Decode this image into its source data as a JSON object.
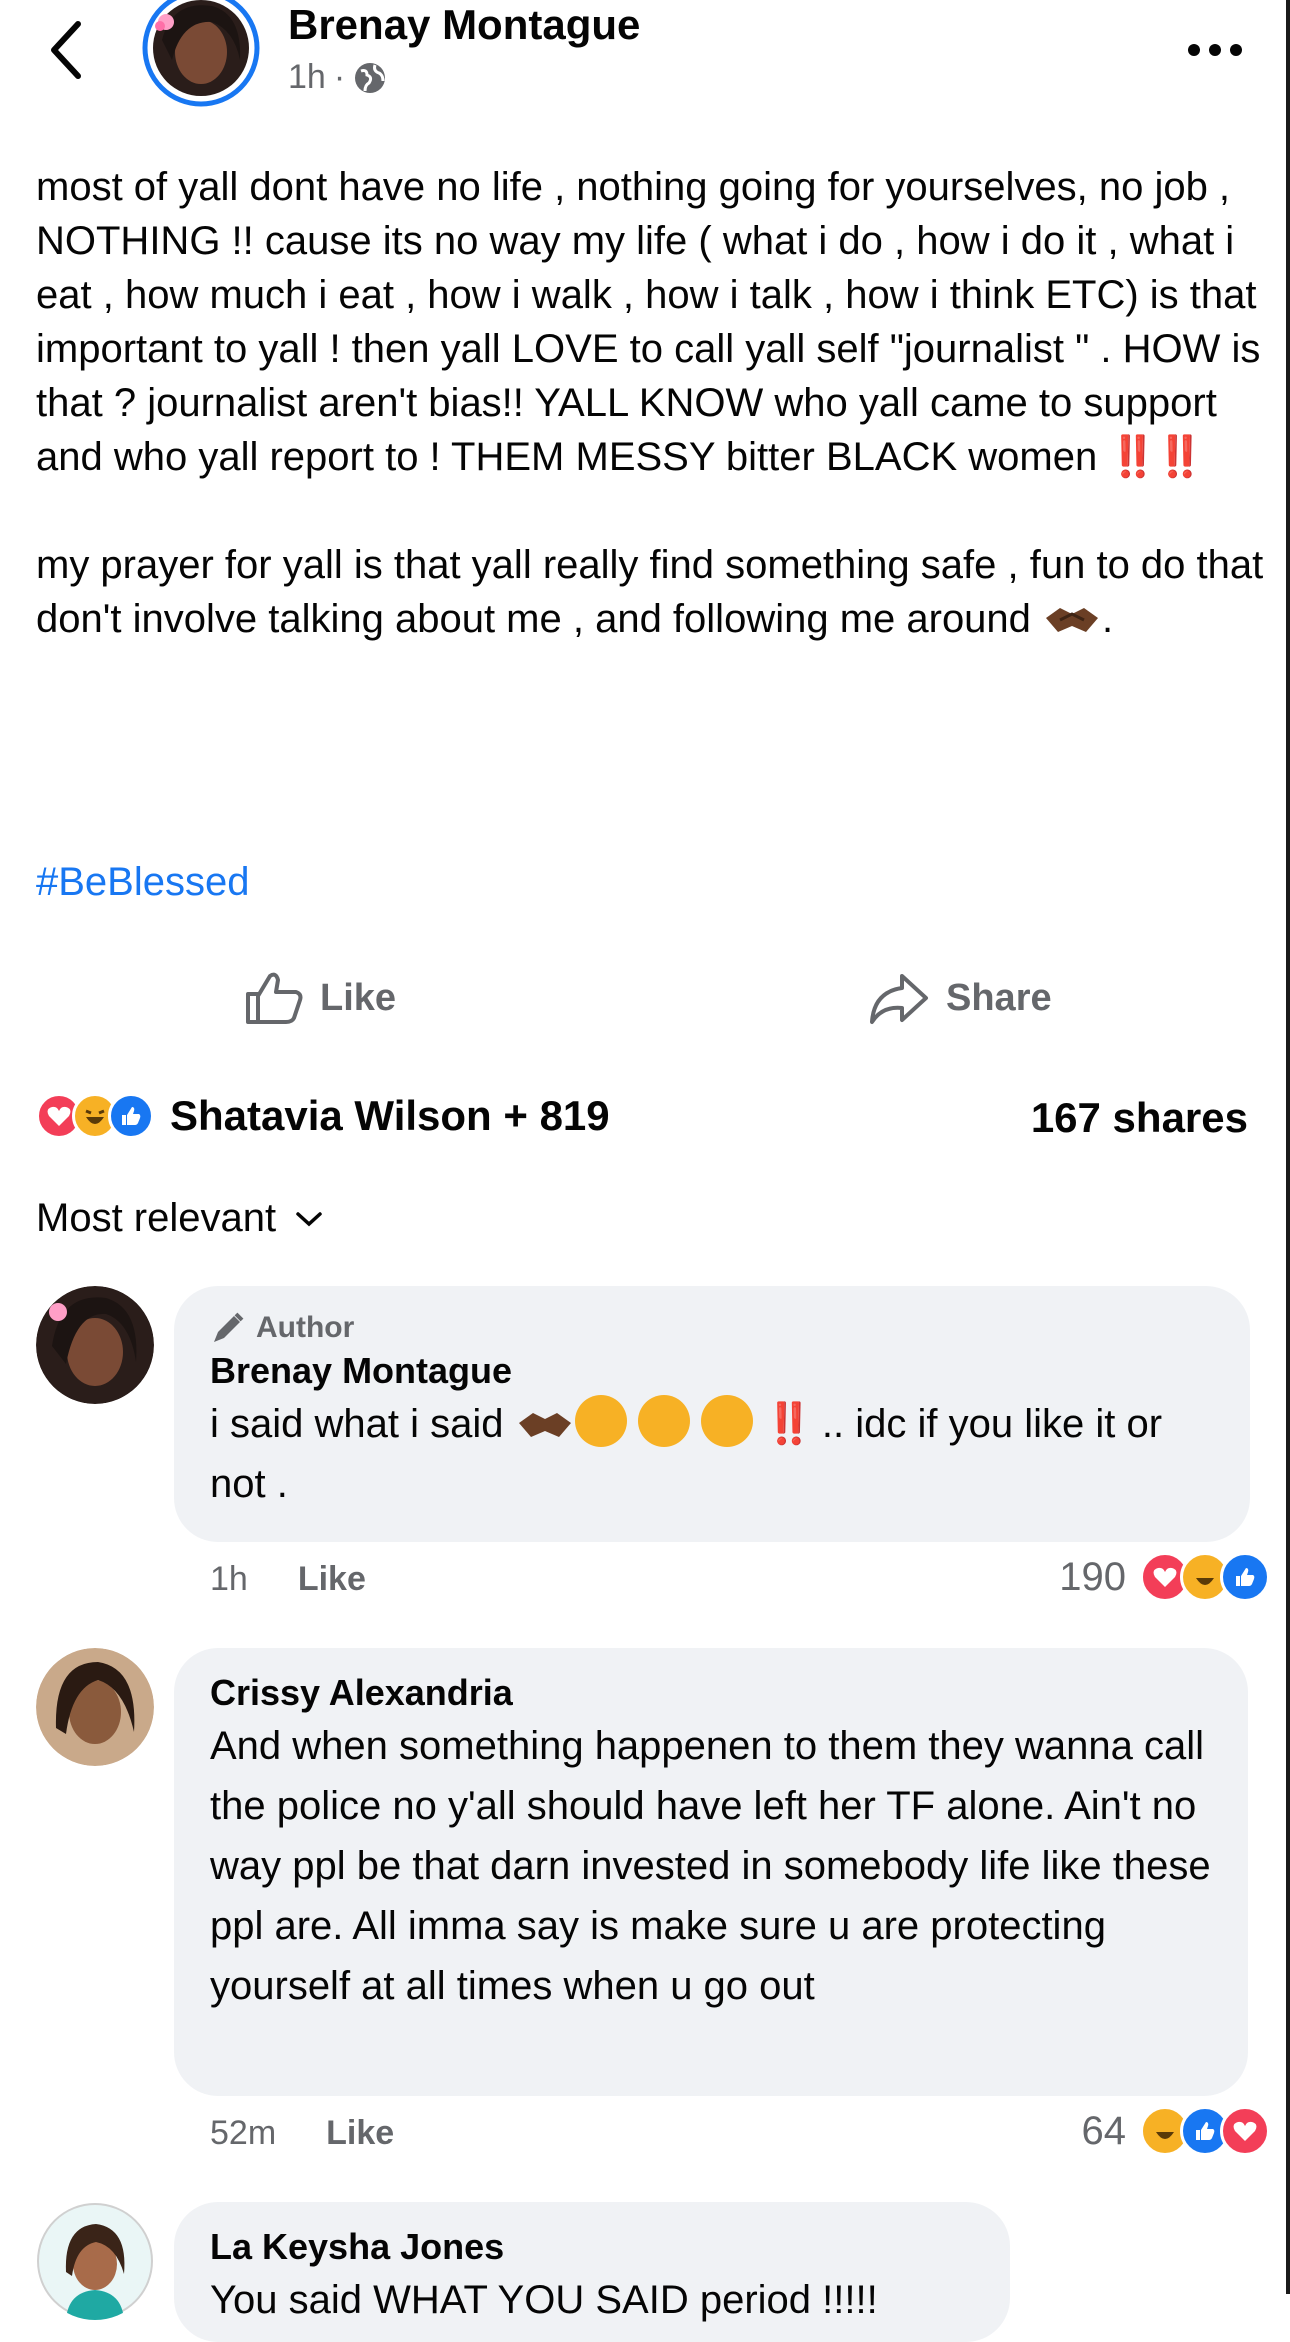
{
  "header": {
    "author": "Brenay Montague",
    "time": "1h",
    "separator": "·"
  },
  "post": {
    "paragraph1": "most of yall dont have no life , nothing going for yourselves, no job , NOTHING !! cause its no way my life ( what i do , how i do it , what i eat , how much i eat , how i walk , how i talk , how i think ETC) is that important to yall ! then yall LOVE to call yall self \"journalist \" . HOW is that ? journalist aren't bias!! YALL KNOW who yall came to support and who yall report to ! THEM MESSY bitter BLACK women",
    "paragraph1_emoji": "‼️‼️",
    "paragraph2": "my prayer for yall is that yall really find something safe , fun to do that don't involve talking about me , and following me around",
    "paragraph2_end": ".",
    "hashtag": "#BeBlessed"
  },
  "actions": {
    "like": "Like",
    "share": "Share"
  },
  "summary": {
    "reactors": "Shatavia Wilson + 819",
    "shares": "167 shares",
    "reaction_icons": [
      "love-icon",
      "haha-icon",
      "like-icon"
    ]
  },
  "sort": {
    "label": "Most relevant"
  },
  "comments": [
    {
      "badge": "Author",
      "name": "Brenay Montague",
      "text_before": "i said what i said",
      "text_after": ".. idc if you like it or not .",
      "time": "1h",
      "like": "Like",
      "count": "190",
      "reactions": [
        "love",
        "haha",
        "like"
      ]
    },
    {
      "name": "Crissy Alexandria",
      "text": "And when something happenen to them they wanna call the police no y'all should have left her TF alone. Ain't no way ppl be that darn invested in somebody life like these ppl are. All imma say is make sure u are protecting yourself at all times when u go out",
      "time": "52m",
      "like": "Like",
      "count": "64",
      "reactions": [
        "haha",
        "like",
        "love"
      ]
    },
    {
      "name": "La Keysha Jones",
      "text": "You said WHAT YOU SAID period !!!!!"
    }
  ],
  "colors": {
    "link": "#1877f2",
    "secondary_text": "#65676b",
    "bubble": "#f0f2f5",
    "love": "#f33e58",
    "haha": "#f7b125",
    "like": "#1877f2"
  }
}
